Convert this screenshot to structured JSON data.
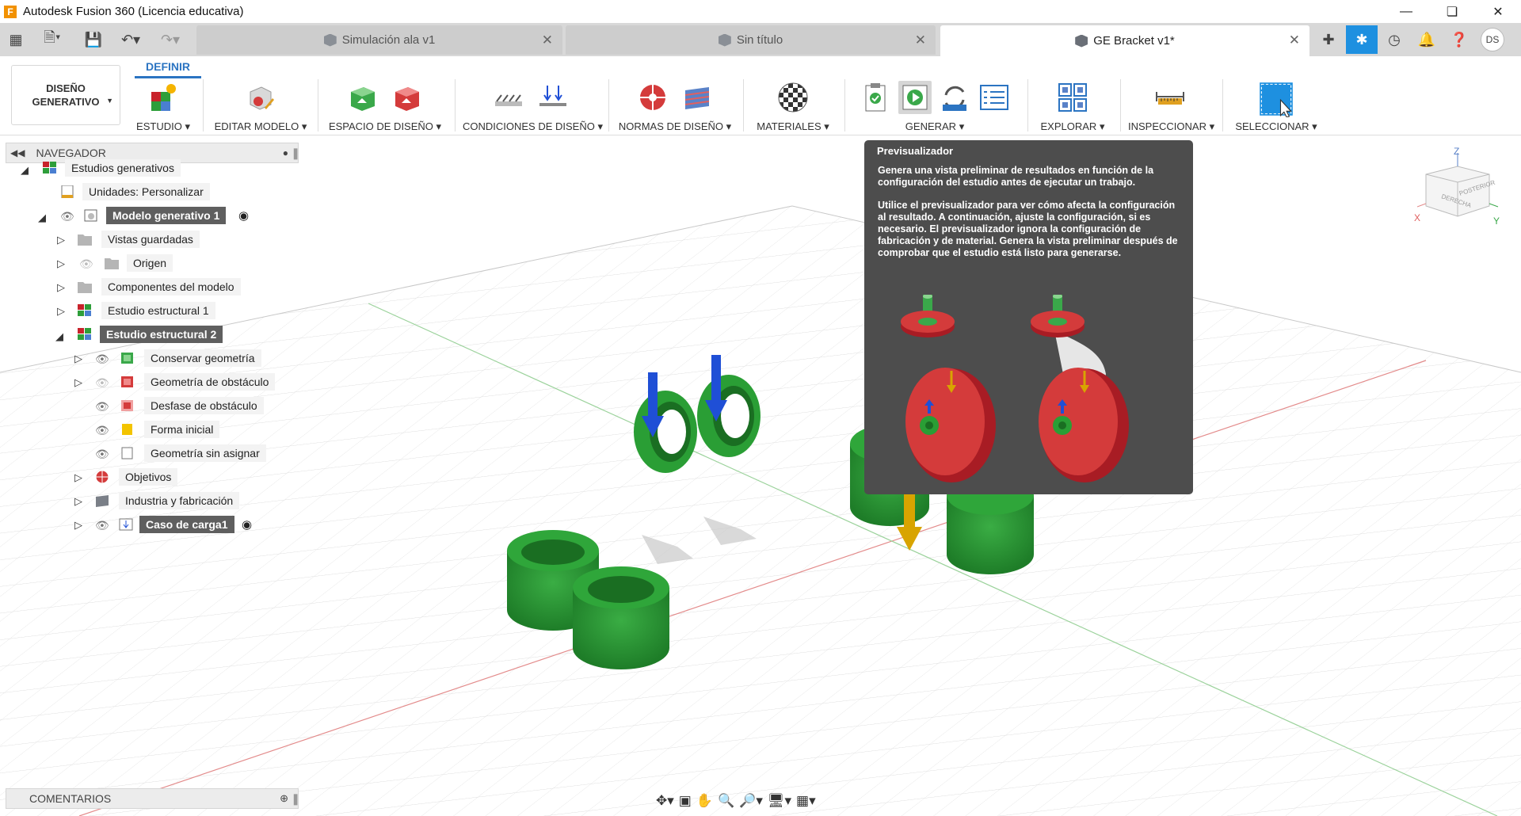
{
  "window": {
    "title": "Autodesk Fusion 360 (Licencia educativa)",
    "logo_letter": "F"
  },
  "tabs": [
    {
      "label": "Simulación ala v1",
      "active": false
    },
    {
      "label": "Sin título",
      "active": false
    },
    {
      "label": "GE Bracket v1*",
      "active": true
    }
  ],
  "user": {
    "initials": "DS"
  },
  "ribbon": {
    "workspace": "DISEÑO\nGENERATIVO",
    "active_tab": "DEFINIR",
    "groups": [
      "ESTUDIO",
      "EDITAR MODELO",
      "ESPACIO DE DISEÑO",
      "CONDICIONES DE DISEÑO",
      "NORMAS DE DISEÑO",
      "MATERIALES",
      "GENERAR",
      "EXPLORAR",
      "INSPECCIONAR",
      "SELECCIONAR"
    ]
  },
  "navigator": {
    "title": "NAVEGADOR",
    "items": [
      {
        "label": "Estudios generativos"
      },
      {
        "label": "Unidades: Personalizar"
      },
      {
        "label": "Modelo generativo 1"
      },
      {
        "label": "Vistas guardadas"
      },
      {
        "label": "Origen"
      },
      {
        "label": "Componentes del modelo"
      },
      {
        "label": "Estudio estructural 1"
      },
      {
        "label": "Estudio estructural 2"
      },
      {
        "label": "Conservar geometría"
      },
      {
        "label": "Geometría de obstáculo"
      },
      {
        "label": "Desfase de obstáculo"
      },
      {
        "label": "Forma inicial"
      },
      {
        "label": "Geometría sin asignar"
      },
      {
        "label": "Objetivos"
      },
      {
        "label": "Industria y fabricación"
      },
      {
        "label": "Caso de carga1"
      }
    ]
  },
  "tooltip": {
    "title": "Previsualizador",
    "para1": "Genera una vista preliminar de resultados en función de la configuración del estudio antes de ejecutar un trabajo.",
    "para2": "Utilice el previsualizador para ver cómo afecta la configuración al resultado. A continuación, ajuste la configuración, si es necesario. El previsualizador ignora la configuración de fabricación y de material. Genera la vista preliminar después de comprobar que el estudio está listo para generarse."
  },
  "comments": {
    "title": "COMENTARIOS"
  },
  "viewcube": {
    "face1": "DERECHA",
    "face2": "POSTERIOR",
    "axis_x": "X",
    "axis_y": "Y",
    "axis_z": "Z"
  },
  "colors": {
    "accent": "#2b74c2",
    "keep_green": "#2e9e3a",
    "obstacle_red": "#c8232b",
    "load_blue": "#1f4fd6",
    "load_yellow": "#d8a400",
    "tooltip_bg": "#4d4d4d",
    "selected_row": "#5f5f5f"
  }
}
